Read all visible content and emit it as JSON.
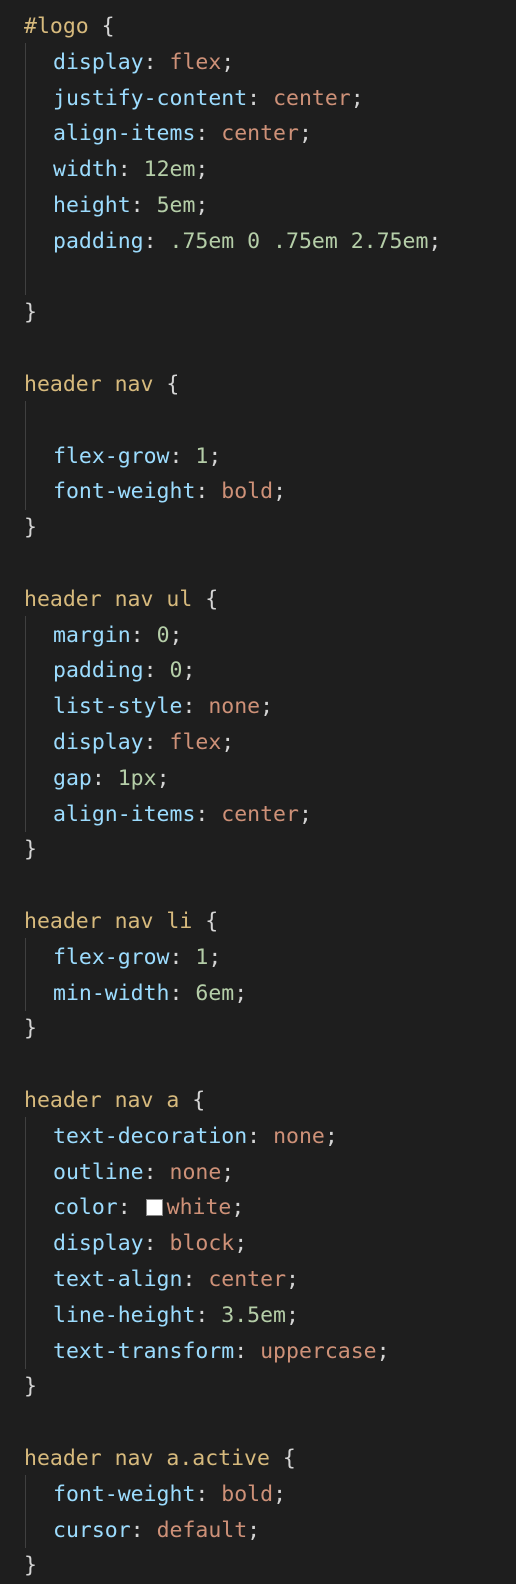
{
  "editor": {
    "blocks": [
      {
        "selector": "#logo",
        "lines": [
          {
            "prop": "display",
            "values": [
              {
                "t": "kw",
                "v": "flex"
              }
            ]
          },
          {
            "prop": "justify-content",
            "values": [
              {
                "t": "kw",
                "v": "center"
              }
            ]
          },
          {
            "prop": "align-items",
            "values": [
              {
                "t": "kw",
                "v": "center"
              }
            ]
          },
          {
            "prop": "width",
            "values": [
              {
                "t": "num",
                "v": "12em"
              }
            ]
          },
          {
            "prop": "height",
            "values": [
              {
                "t": "num",
                "v": "5em"
              }
            ]
          },
          {
            "prop": "padding",
            "values": [
              {
                "t": "num",
                "v": ".75em 0 .75em 2.75em"
              }
            ]
          },
          {
            "blank": true
          }
        ]
      },
      {
        "selector": "header nav",
        "lines": [
          {
            "blank": true
          },
          {
            "prop": "flex-grow",
            "values": [
              {
                "t": "num",
                "v": "1"
              }
            ]
          },
          {
            "prop": "font-weight",
            "values": [
              {
                "t": "kw",
                "v": "bold"
              }
            ]
          }
        ]
      },
      {
        "selector": "header nav ul",
        "lines": [
          {
            "prop": "margin",
            "values": [
              {
                "t": "num",
                "v": "0"
              }
            ]
          },
          {
            "prop": "padding",
            "values": [
              {
                "t": "num",
                "v": "0"
              }
            ]
          },
          {
            "prop": "list-style",
            "values": [
              {
                "t": "kw",
                "v": "none"
              }
            ]
          },
          {
            "prop": "display",
            "values": [
              {
                "t": "kw",
                "v": "flex"
              }
            ]
          },
          {
            "prop": "gap",
            "values": [
              {
                "t": "num",
                "v": "1px"
              }
            ]
          },
          {
            "prop": "align-items",
            "values": [
              {
                "t": "kw",
                "v": "center"
              }
            ]
          }
        ]
      },
      {
        "selector": "header nav li",
        "lines": [
          {
            "prop": "flex-grow",
            "values": [
              {
                "t": "num",
                "v": "1"
              }
            ]
          },
          {
            "prop": "min-width",
            "values": [
              {
                "t": "num",
                "v": "6em"
              }
            ]
          }
        ]
      },
      {
        "selector": "header nav a",
        "lines": [
          {
            "prop": "text-decoration",
            "values": [
              {
                "t": "kw",
                "v": "none"
              }
            ]
          },
          {
            "prop": "outline",
            "values": [
              {
                "t": "kw",
                "v": "none"
              }
            ]
          },
          {
            "prop": "color",
            "swatch": "#ffffff",
            "values": [
              {
                "t": "kw",
                "v": "white"
              }
            ]
          },
          {
            "prop": "display",
            "values": [
              {
                "t": "kw",
                "v": "block"
              }
            ]
          },
          {
            "prop": "text-align",
            "values": [
              {
                "t": "kw",
                "v": "center"
              }
            ]
          },
          {
            "prop": "line-height",
            "values": [
              {
                "t": "num",
                "v": "3.5em"
              }
            ]
          },
          {
            "prop": "text-transform",
            "values": [
              {
                "t": "kw",
                "v": "uppercase"
              }
            ]
          }
        ]
      },
      {
        "selector": "header nav a.active",
        "lines": [
          {
            "prop": "font-weight",
            "values": [
              {
                "t": "kw",
                "v": "bold"
              }
            ]
          },
          {
            "prop": "cursor",
            "values": [
              {
                "t": "kw",
                "v": "default"
              }
            ]
          }
        ]
      }
    ],
    "colors": {
      "background": "#1e1e1e",
      "selector": "#d7ba7d",
      "property": "#9cdcfe",
      "keyword": "#ce9178",
      "number": "#b5cea8",
      "punctuation": "#d4d4d4"
    }
  }
}
